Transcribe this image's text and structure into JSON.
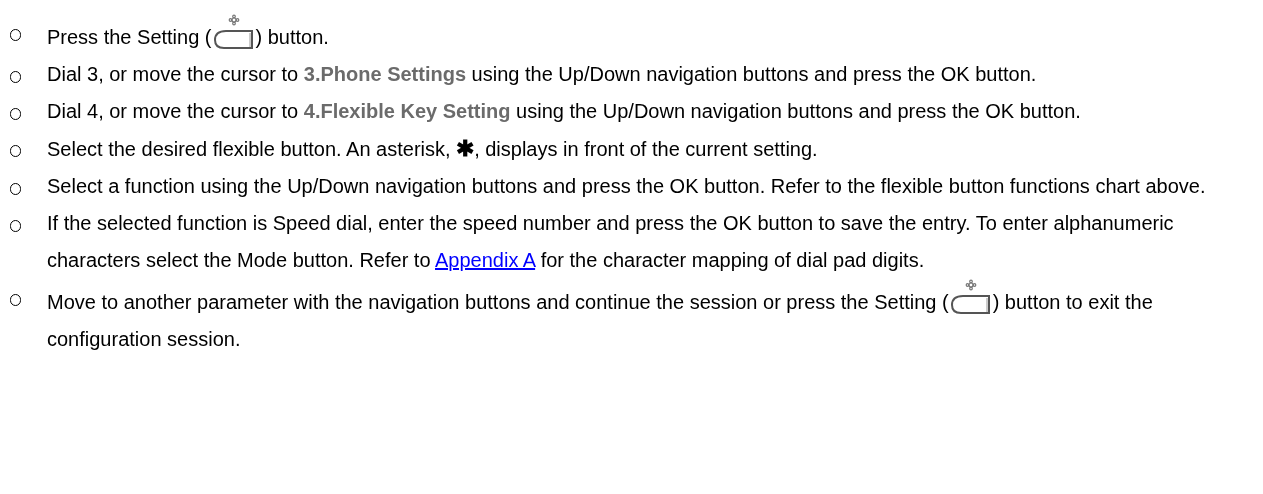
{
  "steps": [
    {
      "parts": [
        {
          "kind": "text",
          "text": "Press the Setting ("
        },
        {
          "kind": "setting_key"
        },
        {
          "kind": "text",
          "text": ") button."
        }
      ]
    },
    {
      "parts": [
        {
          "kind": "text",
          "text": "Dial 3, or move the cursor to "
        },
        {
          "kind": "menu",
          "text": "3.Phone Settings"
        },
        {
          "kind": "text",
          "text": " using the Up/Down navigation buttons and press the OK button."
        }
      ]
    },
    {
      "parts": [
        {
          "kind": "text",
          "text": "Dial 4, or move the cursor to "
        },
        {
          "kind": "menu",
          "text": "4.Flexible Key Setting"
        },
        {
          "kind": "text",
          "text": " using the Up/Down navigation buttons and press the OK button."
        }
      ]
    },
    {
      "parts": [
        {
          "kind": "text",
          "text": "Select the desired flexible button.  An asterisk, "
        },
        {
          "kind": "symbol",
          "text": "✱"
        },
        {
          "kind": "text",
          "text": ", displays in front of the current setting."
        }
      ]
    },
    {
      "parts": [
        {
          "kind": "text",
          "text": "Select a function using the Up/Down navigation buttons and press the OK button. Refer to the flexible button functions chart above."
        }
      ]
    },
    {
      "parts": [
        {
          "kind": "text",
          "text": "If the selected function is Speed dial, enter the speed number and press the OK button to save the entry.  To enter alphanumeric characters select the Mode button.  Refer to "
        },
        {
          "kind": "link",
          "text": "Appendix A"
        },
        {
          "kind": "text",
          "text": " for the character mapping of dial pad digits."
        }
      ]
    },
    {
      "parts": [
        {
          "kind": "text",
          "text": "Move to another parameter with the navigation buttons and continue the session or press the Setting ("
        },
        {
          "kind": "setting_key"
        },
        {
          "kind": "text",
          "text": ") button to exit the configuration session."
        }
      ]
    }
  ]
}
